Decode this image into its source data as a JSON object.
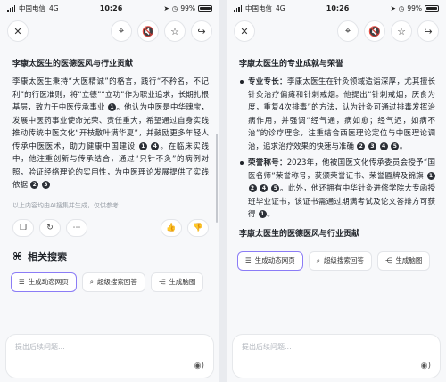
{
  "status": {
    "carrier": "中国电信",
    "network": "4G",
    "time": "10:26",
    "battery": "99%"
  },
  "icons": {
    "close": "close-icon",
    "location": "location-pin-icon",
    "mute": "speaker-mute-icon",
    "star": "star-icon",
    "share": "share-icon",
    "copy": "copy-icon",
    "refresh": "refresh-icon",
    "more": "more-icon",
    "like": "thumbs-up-icon",
    "dislike": "thumbs-down-icon",
    "voice": "voice-icon"
  },
  "left": {
    "heading": "李康太医生的医德医风与行业贡献",
    "para": {
      "t1": "李康太医生秉持“大医精诚”的格言，践行“不矜名，不记利”的行医准则，将“立德”“立功”作为职业追求，长期扎根基层，致力于中医传承事业",
      "r1": "1",
      "t2": "。他认为中医是中华瑰宝，发展中医药事业使命光荣、责任重大，希望通过自身实践推动传统中医文化“开枝散叶满华夏”，并鼓励更多年轻人传承中医医术，助力健康中国建设",
      "r2": "1",
      "r3": "4",
      "t3": "。在临床实践中，他注重创新与传承结合，通过“只针不灸”的病例对照，验证经络理论的实用性，为中医理论发展提供了实践依据",
      "r4": "2",
      "r5": "3",
      "t4": "。"
    },
    "disclaimer": "以上内容均由AI搜集并生成，仅供参考",
    "related_title": "相关搜索",
    "chips": [
      "生成动态网页",
      "超级搜索回答",
      "生成脑图"
    ],
    "input_placeholder": "提出后续问题..."
  },
  "right": {
    "heading": "李康太医生的专业成就与荣誉",
    "item1": {
      "label": "专业专长：",
      "text": "李康太医生在针灸领域造诣深厚，尤其擅长针灸治疗偏瘫和针刺戒烟。他提出“针刺戒烟，厌食为度，重复4次排毒”的方法，认为针灸可通过排毒发挥治病作用，并强调“经气通，病如愈；经气迟，如病不治”的诊疗理念，注重结合西医理论定位与中医理论调治，追求治疗效果的快速与准确",
      "refs": [
        "2",
        "3",
        "4",
        "5"
      ],
      "end": "。"
    },
    "item2": {
      "label": "荣誉称号：",
      "text1": "2023年，他被国医文化传承委员会授予“国医名师”荣誉称号，获颁荣誉证书、荣誉匾牌及锦旗",
      "refs1": [
        "1",
        "2",
        "4",
        "5"
      ],
      "text2": "。此外，他还拥有中华针灸进修学院大专函授班毕业证书，该证书需通过期满考试及论文答辩方可获得",
      "refs2": [
        "1"
      ],
      "end": "。"
    },
    "heading2": "李康太医生的医德医风与行业贡献",
    "chips": [
      "生成动态网页",
      "超级搜索回答",
      "生成脑图"
    ],
    "input_placeholder": "提出后续问题..."
  }
}
